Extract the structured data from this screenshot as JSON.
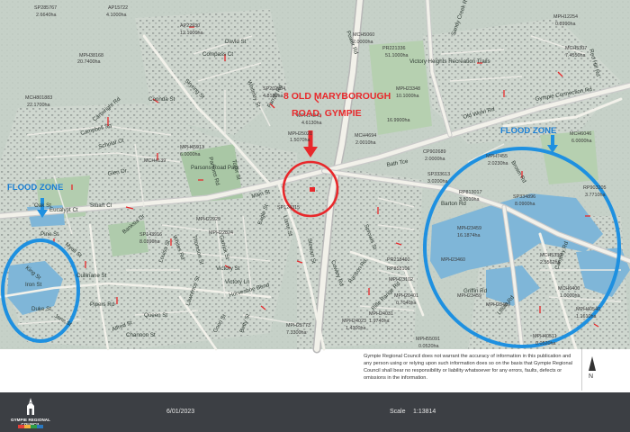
{
  "annotation": {
    "property_line1": "8 OLD MARYBOROUGH",
    "property_line2": "ROAD, GYMPIE",
    "flood_zone_left": "FLOOD ZONE",
    "flood_zone_right": "FLOOD ZONE"
  },
  "colors": {
    "annotation_red": "#e8282b",
    "flood_blue": "#1e90e0",
    "flood_label_blue": "#1a7fd4",
    "water": "#7fb6d8",
    "road_major": "#f2f1ea",
    "road_highway": "#c9c9c9",
    "footer_bg": "#3c3f44"
  },
  "streets": [
    "David St",
    "Compass Ct",
    "Skyring St",
    "Whiteley St",
    "Farrah Rd",
    "Coonda St",
    "Cartwright Rd",
    "Campbell Sq",
    "Scholar Ct",
    "Glen Dr",
    "Parsons Rd",
    "Tozer St",
    "Parsons Road Park",
    "Oak St",
    "Eucalypt Ct",
    "Stuart Cl",
    "Pine St",
    "Myall St",
    "King St",
    "Iron St",
    "Duke St",
    "Jane St",
    "Alfred St",
    "Cullinane St",
    "Banksia Dr",
    "Whites Rd",
    "Thomson St",
    "Garrick St",
    "Louisa St",
    "Victory St",
    "Victory Ln",
    "Horseshoe Bend",
    "Lawrence St",
    "Queen St",
    "Channon St",
    "Pipers Rd",
    "Main St",
    "Eagle St",
    "Lorne St",
    "Coon St",
    "Betty St",
    "Stewart St",
    "Cowley Rd",
    "Ranson Rd",
    "Barton Rd",
    "Sprowls St",
    "Rifle Range Rd",
    "Bath Tce",
    "Old Wolvi Rd",
    "Gympie Connection Rd",
    "Brown Rd",
    "Griffin Rd",
    "Lillian Rd",
    "Cambey Rd",
    "Red Hill Rd",
    "Sandy Creek Rd",
    "Victory Heights Recreation Trails",
    "Power Rd"
  ],
  "lots": [
    "SP285767",
    "2.6640ha",
    "AP15722",
    "4.1000ha",
    "AP22930",
    "12.1000ha",
    "MPH38168",
    "20.7400ha",
    "MCH801883",
    "22.1700ha",
    "MPH45913",
    "6.0000ha",
    "MCH4139",
    "SP143916",
    "8.0390ha",
    "MPH22929",
    "MPH22824",
    "SP202504",
    "4.8180ha",
    "MPH14243",
    "4.6130ha",
    "MPH25021",
    "1.5070ha",
    "MCH4694",
    "2.0010ha",
    "PR221336",
    "51.1000ha",
    "16.9900ha",
    "MCH5060",
    "2.0000ha",
    "CP902689",
    "2.0000ha",
    "SP333613",
    "3.0200ha",
    "RP813017",
    "3.8010ha",
    "SP334896",
    "8.0900ha",
    "MPH23459",
    "16.1874ha",
    "MPH23459",
    "MCH5336",
    "2.5562ha",
    "MPH40540",
    "1.1610ha",
    "MPH40511",
    "0.0520ha",
    "MPH24031",
    "1.9740ha",
    "MPH24023",
    "1.4300ha",
    "MPH25773",
    "7.3300ha",
    "MPH23102",
    "MPH23460",
    "MPH20401",
    "0.7040ha",
    "MPH23348",
    "10.1000ha",
    "MPH12254",
    "0.8990ha",
    "MCH5307",
    "7.4550ha",
    "MPH7455",
    "2.0230ha",
    "MCH6046",
    "6.0000ha",
    "RP903205",
    "3.7710ha",
    "SP124315",
    "MPH23459",
    "MCH6400",
    "1.0000ha",
    "MPH55091",
    "0.0520ha",
    "PR218460",
    "RP858106"
  ],
  "disclaimer": "Gympie Regional Council does not warrant the accuracy of information in this publication and any person using or relying upon such information does so on the basis that Gympie Regional Council shall bear no responsibility or liability whatsoever for any errors, faults, defects or omissions in the information.",
  "north_label": "N",
  "footer": {
    "logo_name": "GYMPIE REGIONAL COUNCIL",
    "logo_colors": [
      "#e2403a",
      "#f3b33d",
      "#2e9d47",
      "#2a79c1"
    ],
    "date": "6/01/2023",
    "scale_label": "Scale",
    "scale_value": "1:13814"
  }
}
